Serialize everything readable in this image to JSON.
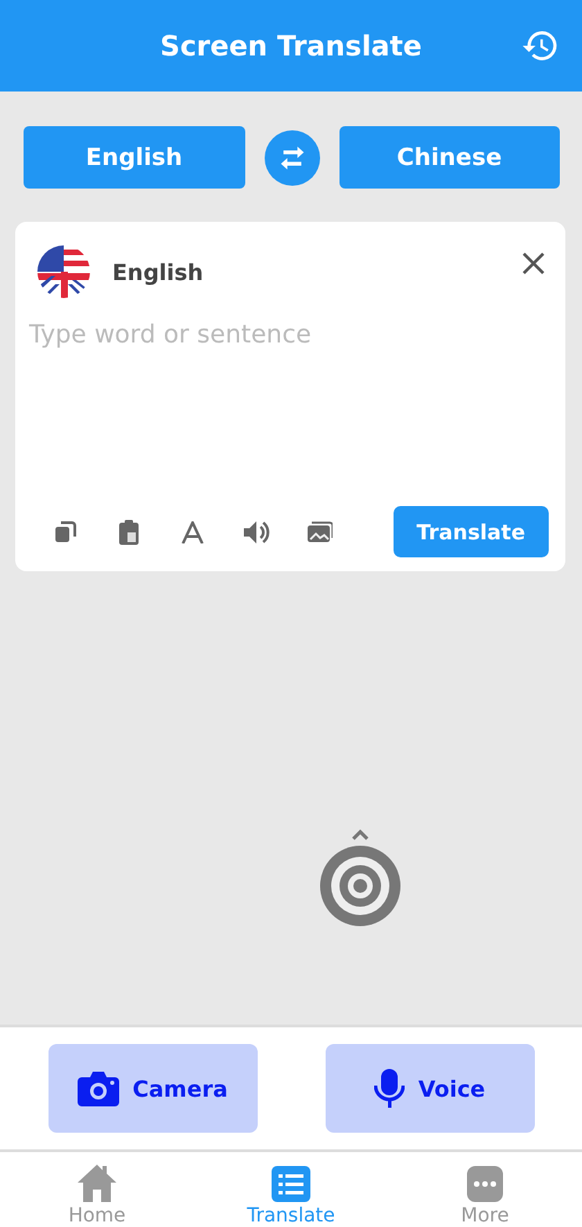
{
  "header": {
    "title": "Screen Translate"
  },
  "languages": {
    "source": "English",
    "target": "Chinese"
  },
  "input_card": {
    "language": "English",
    "placeholder": "Type word or sentence",
    "tools": [
      {
        "kind": "copy"
      },
      {
        "kind": "paste"
      },
      {
        "kind": "font"
      },
      {
        "kind": "speak"
      },
      {
        "kind": "image"
      }
    ],
    "action": "Translate"
  },
  "actions": [
    {
      "kind": "camera",
      "label": "Camera"
    },
    {
      "kind": "voice",
      "label": "Voice"
    }
  ],
  "tabs": [
    {
      "kind": "home",
      "label": "Home",
      "selected": false
    },
    {
      "kind": "translate",
      "label": "Translate",
      "selected": true
    },
    {
      "kind": "more",
      "label": "More",
      "selected": false
    }
  ]
}
